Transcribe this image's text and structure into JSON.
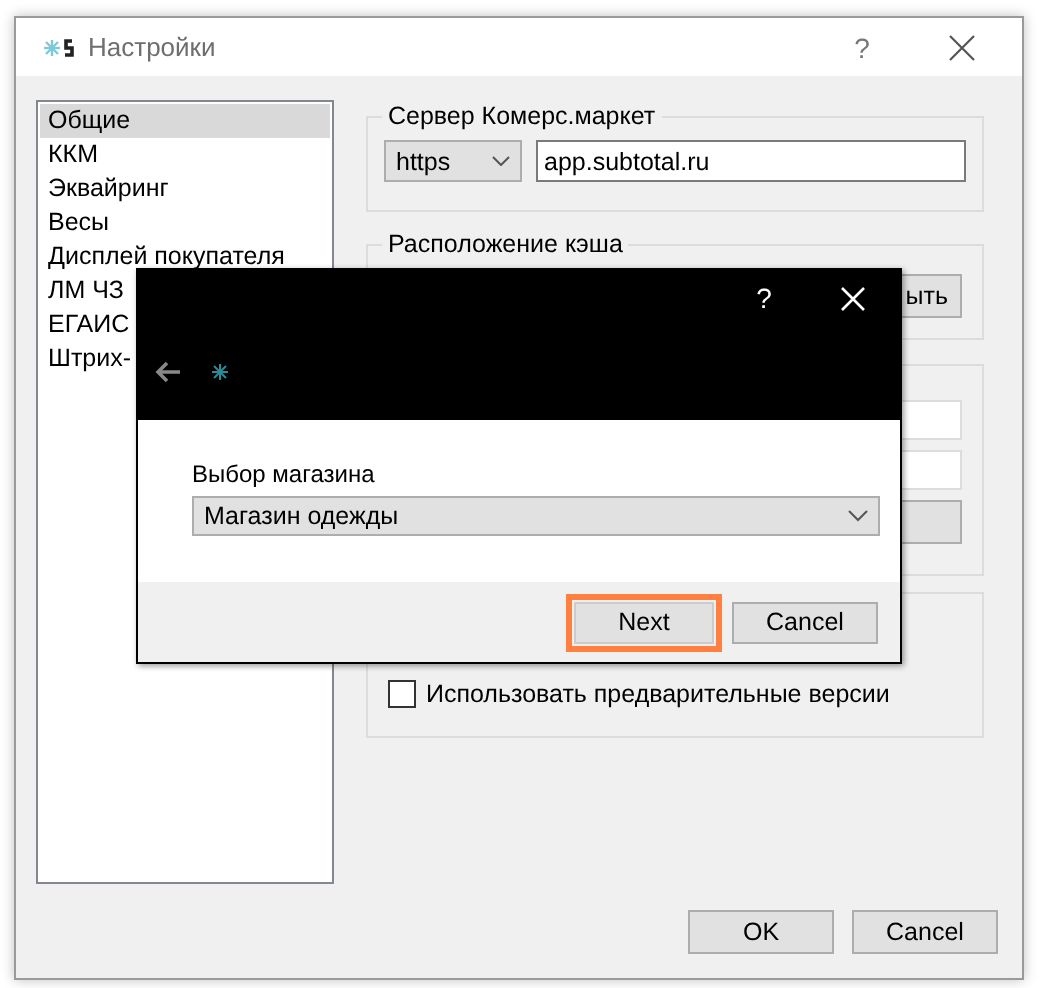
{
  "window": {
    "title": "Настройки",
    "help": "?"
  },
  "sidebar": {
    "items": [
      {
        "label": "Общие",
        "selected": true
      },
      {
        "label": "ККМ",
        "selected": false
      },
      {
        "label": "Эквайринг",
        "selected": false
      },
      {
        "label": "Весы",
        "selected": false
      },
      {
        "label": "Дисплей покупателя",
        "selected": false
      },
      {
        "label": "ЛМ ЧЗ",
        "selected": false
      },
      {
        "label": "ЕГАИС",
        "selected": false
      },
      {
        "label": "Штрих-",
        "selected": false
      }
    ]
  },
  "server_group": {
    "title": "Сервер Комерс.маркет",
    "scheme": "https",
    "host": "app.subtotal.ru"
  },
  "cache_group": {
    "title": "Расположение кэша",
    "button": "ыть"
  },
  "options_group": {
    "checkbox": {
      "label": "Использовать предварительные версии",
      "checked": false
    }
  },
  "buttons": [
    "OK",
    "Cancel"
  ],
  "modal": {
    "help": "?",
    "label": "Выбор магазина",
    "store": "Магазин одежды",
    "buttons": [
      {
        "label": "Next",
        "focused": true
      },
      {
        "label": "Cancel",
        "focused": false
      }
    ]
  }
}
